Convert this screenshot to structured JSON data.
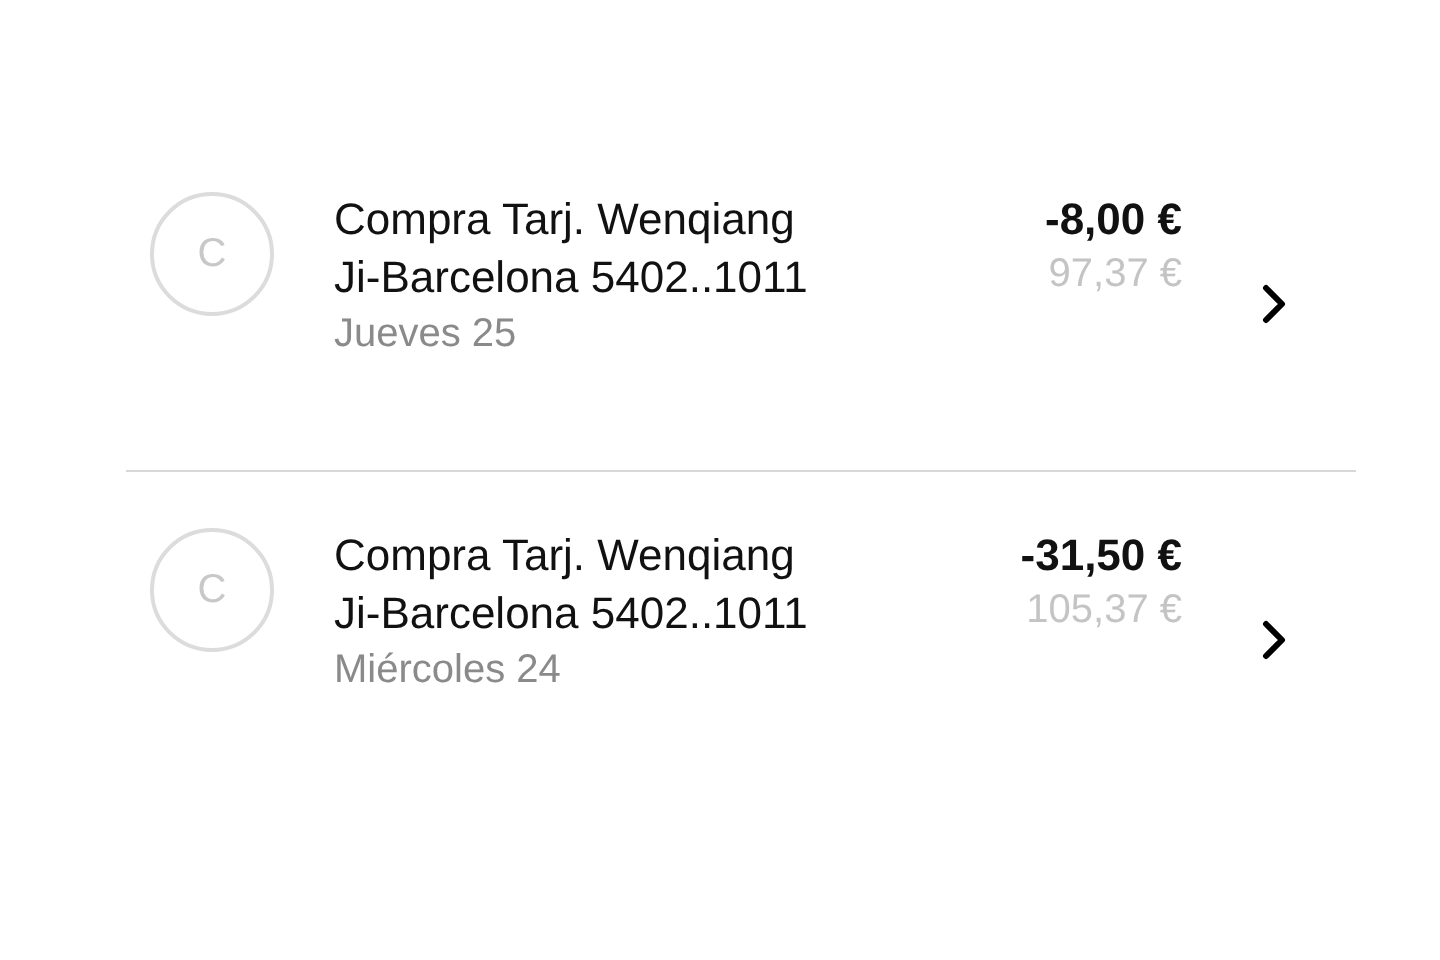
{
  "transactions": [
    {
      "initial": "C",
      "description": "Compra Tarj. Wenqiang Ji-Barcelona 5402..1011",
      "date": "Jueves 25",
      "amount": "-8,00 €",
      "balance": "97,37 €"
    },
    {
      "initial": "C",
      "description": "Compra Tarj. Wenqiang Ji-Barcelona 5402..1011",
      "date": "Miércoles 24",
      "amount": "-31,50 €",
      "balance": "105,37 €"
    }
  ]
}
